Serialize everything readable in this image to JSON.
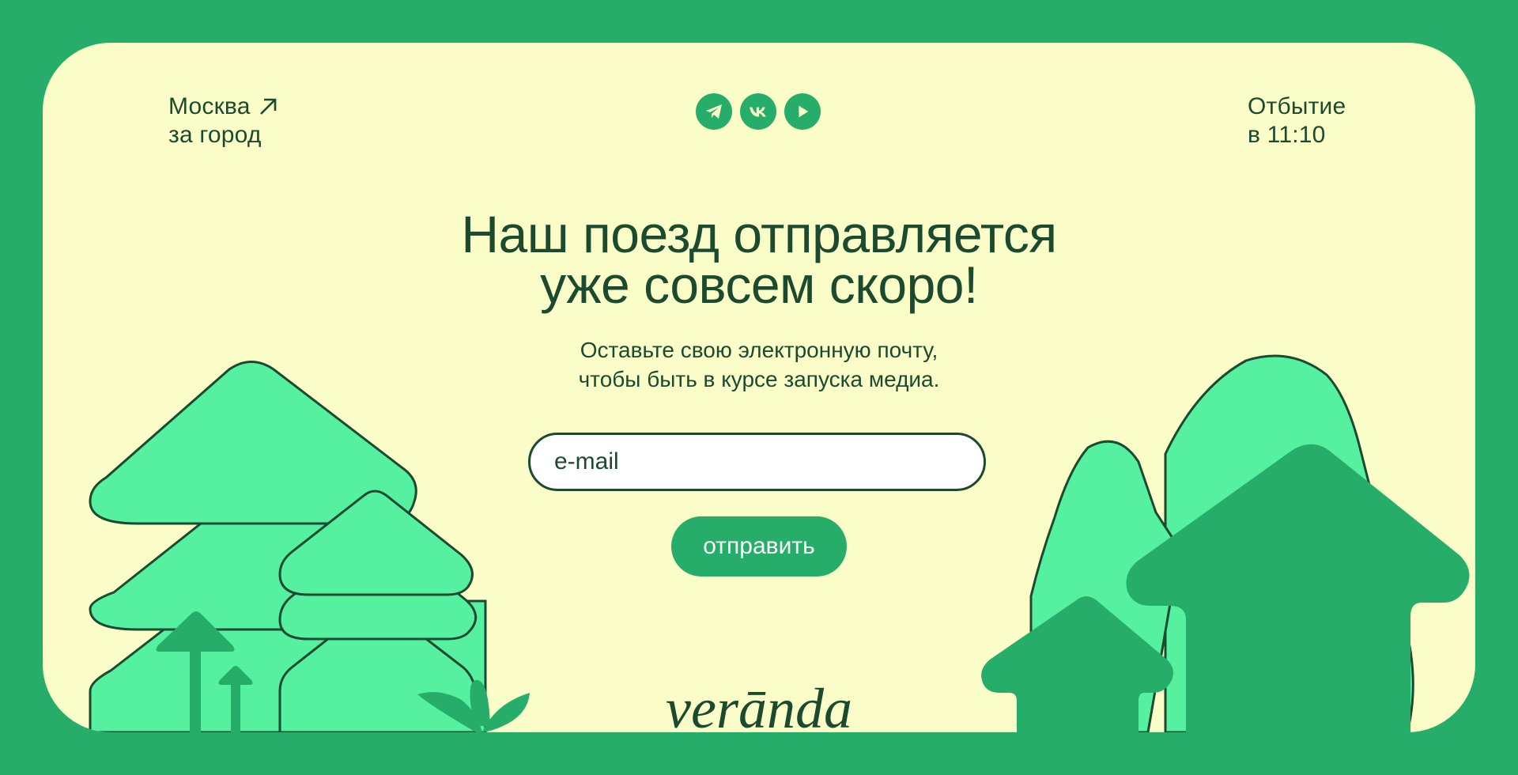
{
  "location": {
    "line1": "Москва",
    "line2": "за город",
    "arrow_icon": "arrow-up-right-icon"
  },
  "departure": {
    "line1": "Отбытие",
    "line2": "в 11:10"
  },
  "social": [
    {
      "name": "telegram",
      "icon": "telegram-icon"
    },
    {
      "name": "vk",
      "icon": "vk-icon"
    },
    {
      "name": "youtube",
      "icon": "play-icon"
    }
  ],
  "hero": {
    "title_line1": "Наш поезд отправляется",
    "title_line2": "уже совсем скоро!",
    "subtitle_line1": "Оставьте свою электронную почту,",
    "subtitle_line2": "чтобы быть в курсе запуска медиа."
  },
  "form": {
    "email_placeholder": "e-mail",
    "email_value": "",
    "submit_label": "отправить"
  },
  "brand": {
    "logo_text": "verānda"
  },
  "colors": {
    "frame": "#27ad6a",
    "card": "#fbfdc8",
    "text": "#1c4a2f",
    "tree_light": "#56f0a1",
    "tree_dark": "#27ad6a",
    "outline": "#1c4a2f"
  }
}
